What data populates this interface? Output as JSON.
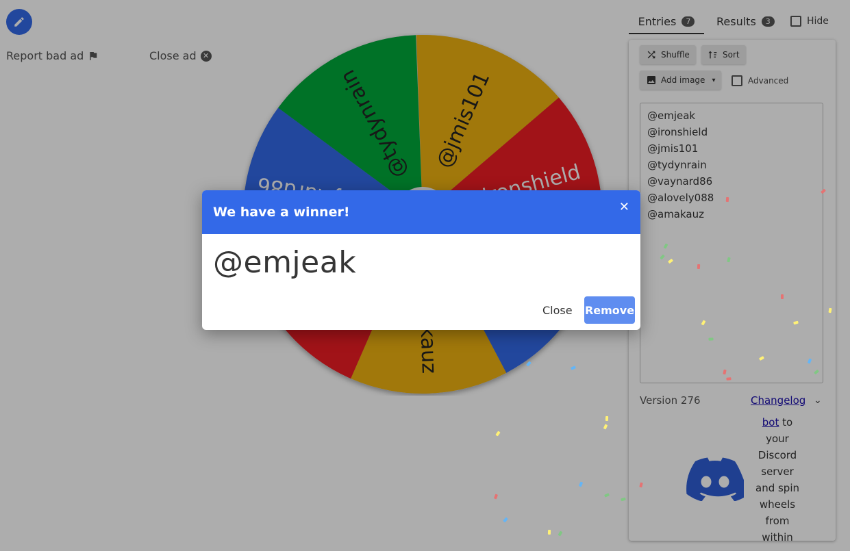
{
  "ads": {
    "report_label": "Report bad ad",
    "close_label": "Close ad"
  },
  "tabs": {
    "entries_label": "Entries",
    "entries_count": "7",
    "results_label": "Results",
    "results_count": "3",
    "hide_label": "Hide"
  },
  "toolbar": {
    "shuffle_label": "Shuffle",
    "sort_label": "Sort",
    "add_image_label": "Add image",
    "advanced_label": "Advanced"
  },
  "entries": [
    "@emjeak",
    "@ironshield",
    "@jmis101",
    "@tydynrain",
    "@vaynard86",
    "@alovely088",
    "@amakauz"
  ],
  "footer": {
    "version": "Version 276",
    "changelog": "Changelog"
  },
  "discord": {
    "link": "bot",
    "lines": [
      "to",
      "your",
      "Discord",
      "server",
      "and spin",
      "wheels",
      "from",
      "within"
    ]
  },
  "wheel": {
    "labels": [
      "@ironshield",
      "@jmis101",
      "@tydynrain",
      "@vaynard86",
      "@alovely088",
      "@amakauz"
    ],
    "colors": {
      "red": "#ee1c24",
      "yellow": "#eeb211",
      "green": "#00a83a",
      "blue": "#3369e8"
    }
  },
  "dialog": {
    "title": "We have a winner!",
    "winner": "@emjeak",
    "close_label": "Close",
    "remove_label": "Remove"
  }
}
